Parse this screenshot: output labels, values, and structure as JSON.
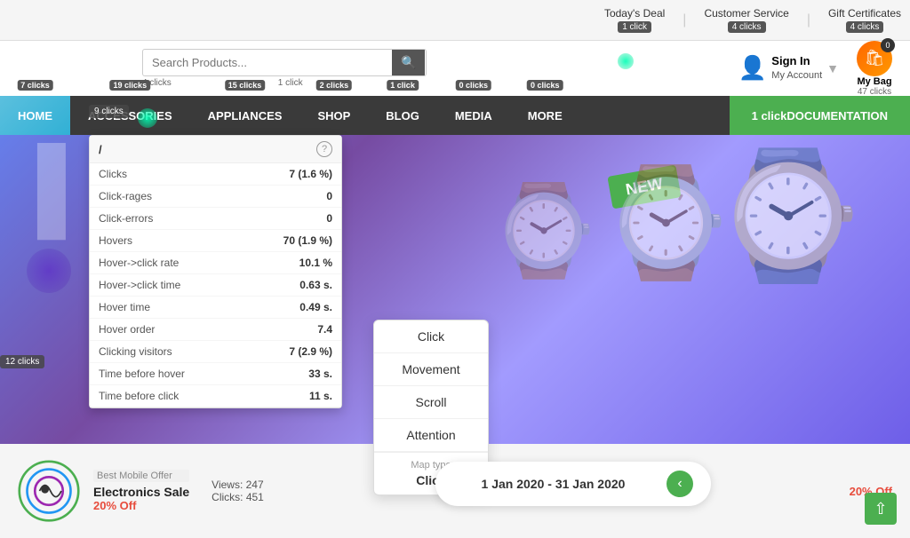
{
  "topbar": {
    "links": [
      {
        "label": "Today's Deal",
        "clicks": "1 click"
      },
      {
        "label": "Customer Service",
        "clicks": "4 clicks"
      },
      {
        "label": "Gift Certificates",
        "clicks": "4 clicks"
      }
    ]
  },
  "header": {
    "search_placeholder": "Search Products...",
    "search_clicks_left": "4 clicks",
    "search_clicks_right": "1 click",
    "account_sign_in": "Sign In",
    "account_my": "My Account",
    "cart_label": "My Bag",
    "cart_clicks": "47 clicks",
    "cart_count": "0"
  },
  "nav": {
    "items": [
      {
        "label": "HOME",
        "clicks": "7 clicks"
      },
      {
        "label": "ACCESSORIES",
        "clicks": "19 clicks"
      },
      {
        "label": "APPLIANCES",
        "clicks": "15 clicks"
      },
      {
        "label": "SHOP",
        "clicks": "2 clicks"
      },
      {
        "label": "BLOG",
        "clicks": "1 click"
      },
      {
        "label": "MEDIA",
        "clicks": "0 clicks"
      },
      {
        "label": "MORE",
        "clicks": "0 clicks"
      }
    ],
    "doc_button": "DOCUMENTATION",
    "doc_clicks": "1 click",
    "home_page_clicks": "9 clicks"
  },
  "tooltip": {
    "path": "/",
    "rows": [
      {
        "label": "Clicks",
        "value": "7 (1.6 %)"
      },
      {
        "label": "Click-rages",
        "value": "0"
      },
      {
        "label": "Click-errors",
        "value": "0"
      },
      {
        "label": "Hovers",
        "value": "70 (1.9 %)"
      },
      {
        "label": "Hover->click rate",
        "value": "10.1 %"
      },
      {
        "label": "Hover->click time",
        "value": "0.63 s."
      },
      {
        "label": "Hover time",
        "value": "0.49 s."
      },
      {
        "label": "Hover order",
        "value": "7.4"
      },
      {
        "label": "Clicking visitors",
        "value": "7 (2.9 %)"
      },
      {
        "label": "Time before hover",
        "value": "33 s."
      },
      {
        "label": "Time before click",
        "value": "11 s."
      }
    ]
  },
  "context_menu": {
    "items": [
      "Click",
      "Movement",
      "Scroll",
      "Attention"
    ],
    "map_type_label": "Map type",
    "map_type_value": "Click"
  },
  "date_range": {
    "text": "1 Jan 2020 - 31 Jan 2020"
  },
  "bottom_strip": {
    "badge": "Best Mobile Offer",
    "title": "Electronics Sale",
    "discount": "20% Off",
    "views": "Views: 247",
    "clicks_count": "Clicks: 451",
    "watch_sale": "20% Off"
  },
  "left_badge": "12 clicks",
  "hero_badge": "NEW",
  "colors": {
    "nav_bg": "#3a3a3a",
    "nav_home": "#5bc0de",
    "doc_btn": "#4caf50",
    "hero_gradient_start": "#6c5ce7",
    "hero_gradient_end": "#a29bfe"
  }
}
